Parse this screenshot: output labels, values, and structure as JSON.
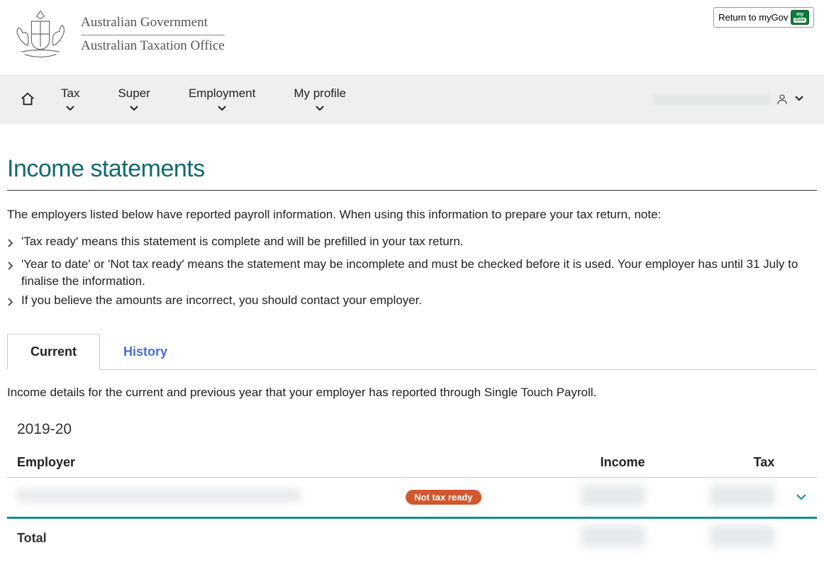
{
  "header": {
    "return_label": "Return to myGov",
    "brand_line1": "Australian Government",
    "brand_line2": "Australian Taxation Office"
  },
  "nav": {
    "tax": "Tax",
    "super": "Super",
    "employment": "Employment",
    "my_profile": "My profile"
  },
  "page": {
    "title": "Income statements",
    "intro": "The employers listed below have reported payroll information. When using this information to prepare your tax return, note:",
    "notes": [
      "'Tax ready' means this statement is complete and will be prefilled in your tax return.",
      "'Year to date' or 'Not tax ready' means the statement may be incomplete and must be checked before it is used. Your employer has until 31 July to finalise the information.",
      "If you believe the amounts are incorrect, you should contact your employer."
    ]
  },
  "tabs": {
    "current": "Current",
    "history": "History",
    "current_desc": "Income details for the current and previous year that your employer has reported through Single Touch Payroll."
  },
  "year_section": {
    "year": "2019-20",
    "columns": {
      "employer": "Employer",
      "income": "Income",
      "tax": "Tax"
    },
    "row_status": "Not tax ready",
    "total_label": "Total"
  }
}
